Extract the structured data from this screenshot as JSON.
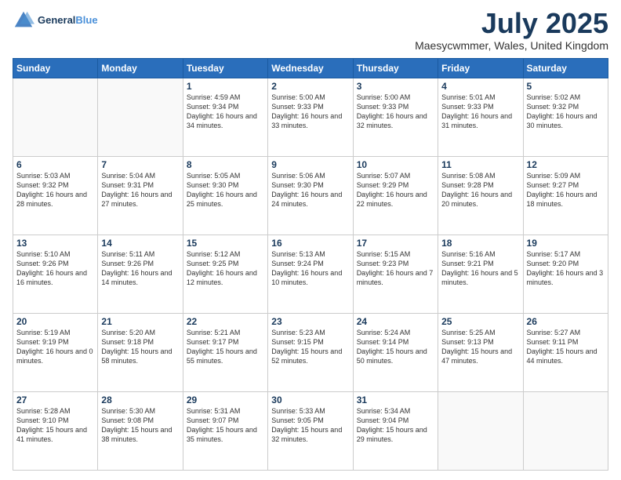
{
  "header": {
    "logo_line1": "General",
    "logo_line2": "Blue",
    "month": "July 2025",
    "location": "Maesycwmmer, Wales, United Kingdom"
  },
  "weekdays": [
    "Sunday",
    "Monday",
    "Tuesday",
    "Wednesday",
    "Thursday",
    "Friday",
    "Saturday"
  ],
  "weeks": [
    [
      {
        "day": "",
        "sunrise": "",
        "sunset": "",
        "daylight": ""
      },
      {
        "day": "",
        "sunrise": "",
        "sunset": "",
        "daylight": ""
      },
      {
        "day": "1",
        "sunrise": "Sunrise: 4:59 AM",
        "sunset": "Sunset: 9:34 PM",
        "daylight": "Daylight: 16 hours and 34 minutes."
      },
      {
        "day": "2",
        "sunrise": "Sunrise: 5:00 AM",
        "sunset": "Sunset: 9:33 PM",
        "daylight": "Daylight: 16 hours and 33 minutes."
      },
      {
        "day": "3",
        "sunrise": "Sunrise: 5:00 AM",
        "sunset": "Sunset: 9:33 PM",
        "daylight": "Daylight: 16 hours and 32 minutes."
      },
      {
        "day": "4",
        "sunrise": "Sunrise: 5:01 AM",
        "sunset": "Sunset: 9:33 PM",
        "daylight": "Daylight: 16 hours and 31 minutes."
      },
      {
        "day": "5",
        "sunrise": "Sunrise: 5:02 AM",
        "sunset": "Sunset: 9:32 PM",
        "daylight": "Daylight: 16 hours and 30 minutes."
      }
    ],
    [
      {
        "day": "6",
        "sunrise": "Sunrise: 5:03 AM",
        "sunset": "Sunset: 9:32 PM",
        "daylight": "Daylight: 16 hours and 28 minutes."
      },
      {
        "day": "7",
        "sunrise": "Sunrise: 5:04 AM",
        "sunset": "Sunset: 9:31 PM",
        "daylight": "Daylight: 16 hours and 27 minutes."
      },
      {
        "day": "8",
        "sunrise": "Sunrise: 5:05 AM",
        "sunset": "Sunset: 9:30 PM",
        "daylight": "Daylight: 16 hours and 25 minutes."
      },
      {
        "day": "9",
        "sunrise": "Sunrise: 5:06 AM",
        "sunset": "Sunset: 9:30 PM",
        "daylight": "Daylight: 16 hours and 24 minutes."
      },
      {
        "day": "10",
        "sunrise": "Sunrise: 5:07 AM",
        "sunset": "Sunset: 9:29 PM",
        "daylight": "Daylight: 16 hours and 22 minutes."
      },
      {
        "day": "11",
        "sunrise": "Sunrise: 5:08 AM",
        "sunset": "Sunset: 9:28 PM",
        "daylight": "Daylight: 16 hours and 20 minutes."
      },
      {
        "day": "12",
        "sunrise": "Sunrise: 5:09 AM",
        "sunset": "Sunset: 9:27 PM",
        "daylight": "Daylight: 16 hours and 18 minutes."
      }
    ],
    [
      {
        "day": "13",
        "sunrise": "Sunrise: 5:10 AM",
        "sunset": "Sunset: 9:26 PM",
        "daylight": "Daylight: 16 hours and 16 minutes."
      },
      {
        "day": "14",
        "sunrise": "Sunrise: 5:11 AM",
        "sunset": "Sunset: 9:26 PM",
        "daylight": "Daylight: 16 hours and 14 minutes."
      },
      {
        "day": "15",
        "sunrise": "Sunrise: 5:12 AM",
        "sunset": "Sunset: 9:25 PM",
        "daylight": "Daylight: 16 hours and 12 minutes."
      },
      {
        "day": "16",
        "sunrise": "Sunrise: 5:13 AM",
        "sunset": "Sunset: 9:24 PM",
        "daylight": "Daylight: 16 hours and 10 minutes."
      },
      {
        "day": "17",
        "sunrise": "Sunrise: 5:15 AM",
        "sunset": "Sunset: 9:23 PM",
        "daylight": "Daylight: 16 hours and 7 minutes."
      },
      {
        "day": "18",
        "sunrise": "Sunrise: 5:16 AM",
        "sunset": "Sunset: 9:21 PM",
        "daylight": "Daylight: 16 hours and 5 minutes."
      },
      {
        "day": "19",
        "sunrise": "Sunrise: 5:17 AM",
        "sunset": "Sunset: 9:20 PM",
        "daylight": "Daylight: 16 hours and 3 minutes."
      }
    ],
    [
      {
        "day": "20",
        "sunrise": "Sunrise: 5:19 AM",
        "sunset": "Sunset: 9:19 PM",
        "daylight": "Daylight: 16 hours and 0 minutes."
      },
      {
        "day": "21",
        "sunrise": "Sunrise: 5:20 AM",
        "sunset": "Sunset: 9:18 PM",
        "daylight": "Daylight: 15 hours and 58 minutes."
      },
      {
        "day": "22",
        "sunrise": "Sunrise: 5:21 AM",
        "sunset": "Sunset: 9:17 PM",
        "daylight": "Daylight: 15 hours and 55 minutes."
      },
      {
        "day": "23",
        "sunrise": "Sunrise: 5:23 AM",
        "sunset": "Sunset: 9:15 PM",
        "daylight": "Daylight: 15 hours and 52 minutes."
      },
      {
        "day": "24",
        "sunrise": "Sunrise: 5:24 AM",
        "sunset": "Sunset: 9:14 PM",
        "daylight": "Daylight: 15 hours and 50 minutes."
      },
      {
        "day": "25",
        "sunrise": "Sunrise: 5:25 AM",
        "sunset": "Sunset: 9:13 PM",
        "daylight": "Daylight: 15 hours and 47 minutes."
      },
      {
        "day": "26",
        "sunrise": "Sunrise: 5:27 AM",
        "sunset": "Sunset: 9:11 PM",
        "daylight": "Daylight: 15 hours and 44 minutes."
      }
    ],
    [
      {
        "day": "27",
        "sunrise": "Sunrise: 5:28 AM",
        "sunset": "Sunset: 9:10 PM",
        "daylight": "Daylight: 15 hours and 41 minutes."
      },
      {
        "day": "28",
        "sunrise": "Sunrise: 5:30 AM",
        "sunset": "Sunset: 9:08 PM",
        "daylight": "Daylight: 15 hours and 38 minutes."
      },
      {
        "day": "29",
        "sunrise": "Sunrise: 5:31 AM",
        "sunset": "Sunset: 9:07 PM",
        "daylight": "Daylight: 15 hours and 35 minutes."
      },
      {
        "day": "30",
        "sunrise": "Sunrise: 5:33 AM",
        "sunset": "Sunset: 9:05 PM",
        "daylight": "Daylight: 15 hours and 32 minutes."
      },
      {
        "day": "31",
        "sunrise": "Sunrise: 5:34 AM",
        "sunset": "Sunset: 9:04 PM",
        "daylight": "Daylight: 15 hours and 29 minutes."
      },
      {
        "day": "",
        "sunrise": "",
        "sunset": "",
        "daylight": ""
      },
      {
        "day": "",
        "sunrise": "",
        "sunset": "",
        "daylight": ""
      }
    ]
  ]
}
